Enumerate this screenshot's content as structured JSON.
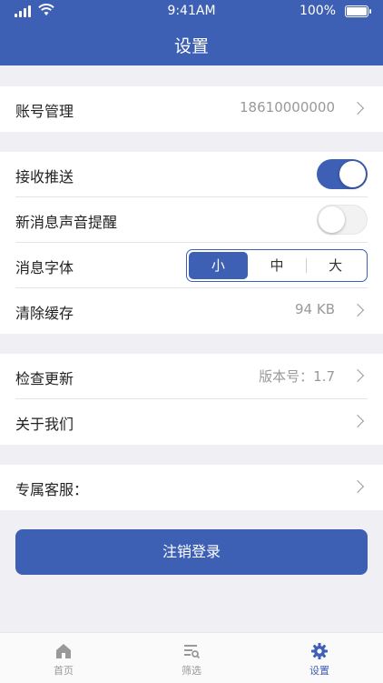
{
  "status_bar": {
    "time": "9:41AM",
    "battery": "100%"
  },
  "header": {
    "title": "设置"
  },
  "account": {
    "label": "账号管理",
    "value": "18610000000"
  },
  "notifications": {
    "push_label": "接收推送",
    "push_enabled": true,
    "sound_label": "新消息声音提醒",
    "sound_enabled": false,
    "font_label": "消息字体",
    "font_options": [
      "小",
      "中",
      "大"
    ],
    "font_selected": "小",
    "cache_label": "清除缓存",
    "cache_value": "94 KB"
  },
  "about": {
    "update_label": "检查更新",
    "version_value": "版本号：1.7",
    "about_label": "关于我们"
  },
  "service": {
    "label": "专属客服："
  },
  "logout_label": "注销登录",
  "tabbar": {
    "home": "首页",
    "filter": "筛选",
    "settings": "设置",
    "active": "settings"
  },
  "colors": {
    "primary": "#3d5fb4",
    "background": "#f0f0f4",
    "muted": "#999999"
  }
}
